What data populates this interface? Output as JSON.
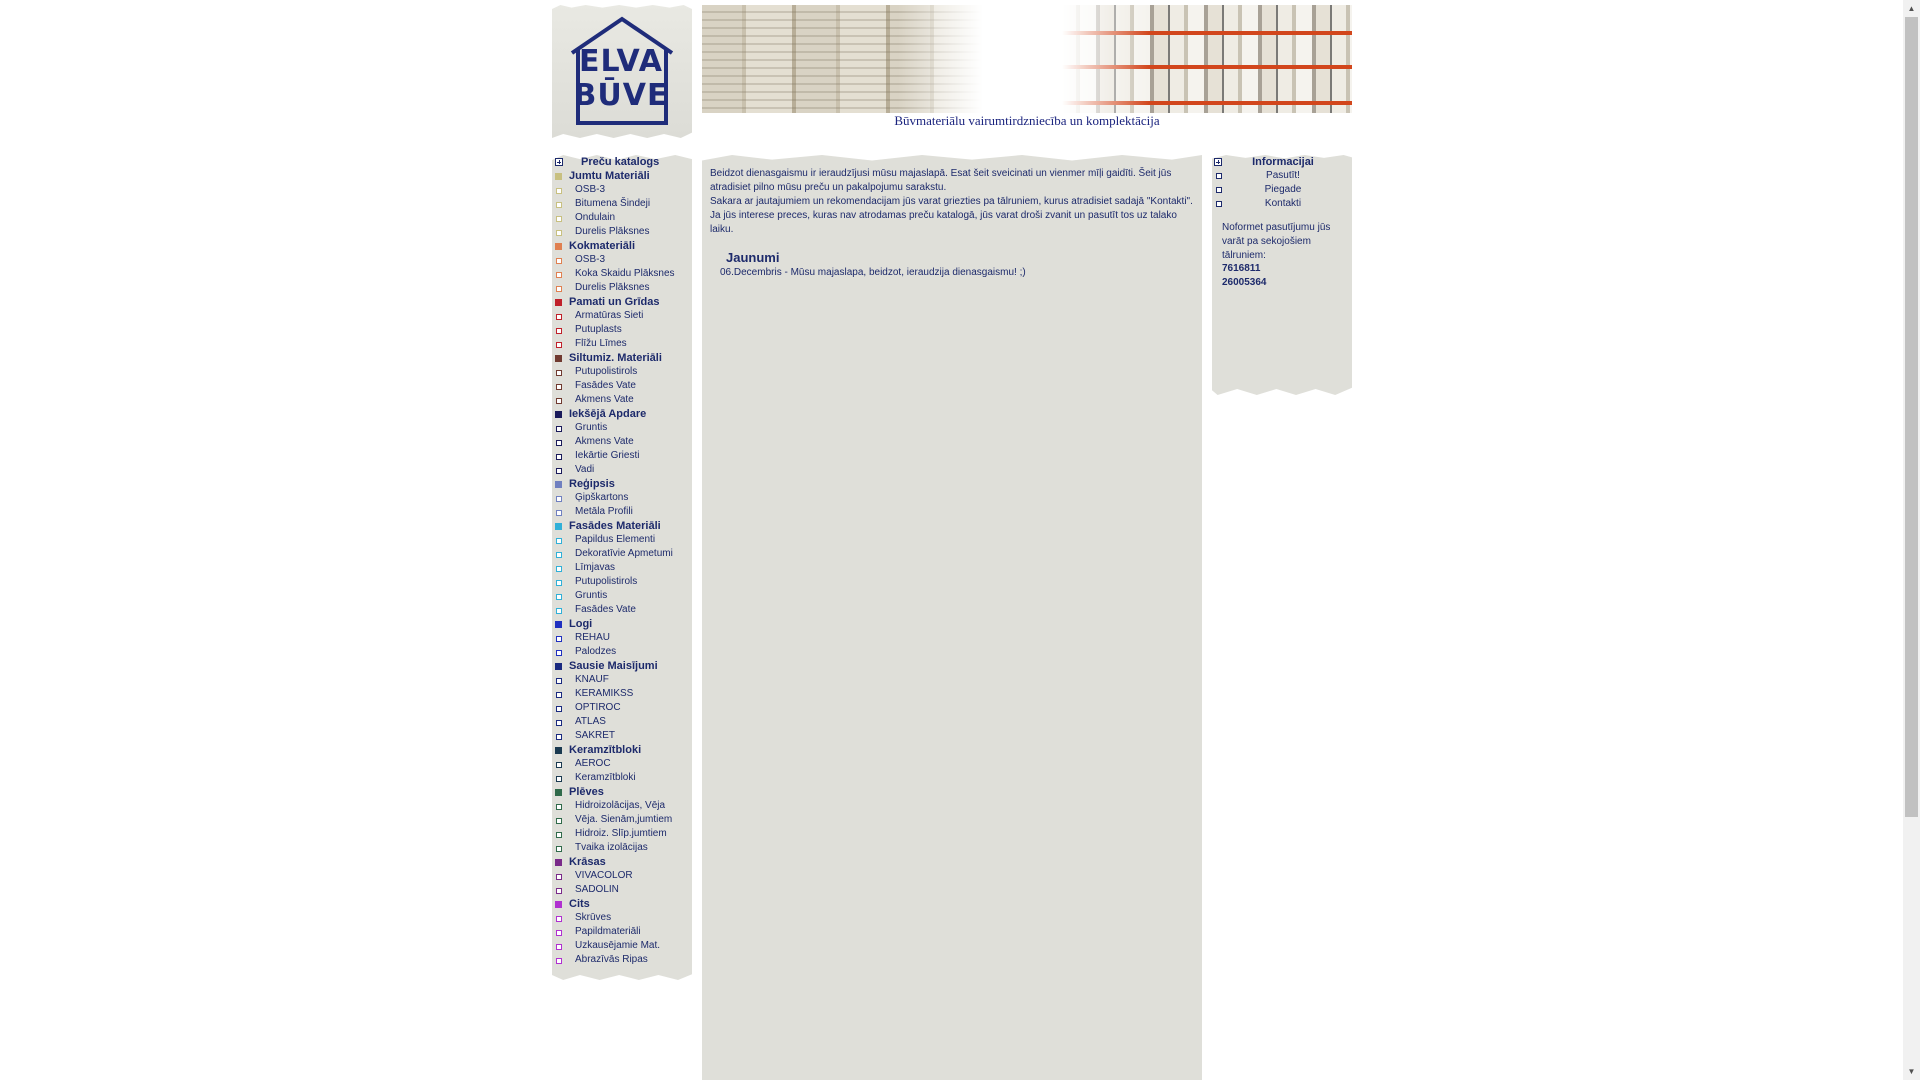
{
  "header": {
    "logo_line1": "ELVA",
    "logo_line2": "BŪVE",
    "tagline": "Būvmateriālu vairumtirdzniecība un komplektācija"
  },
  "catalog": {
    "title": "Preču katalogs",
    "categories": [
      {
        "name": "Jumtu Materiāli",
        "color": "#c8c080",
        "items": [
          "OSB-3",
          "Bitumena Šindeji",
          "Ondulain",
          "Durelis Plāksnes"
        ]
      },
      {
        "name": "Kokmateriāli",
        "color": "#e08050",
        "items": [
          "OSB-3",
          "Koka Skaidu Plāksnes",
          "Durelis Plāksnes"
        ]
      },
      {
        "name": "Pamati un Grīdas",
        "color": "#c0202a",
        "items": [
          "Armatūras Sieti",
          "Putuplasts",
          "Flīžu Līmes"
        ]
      },
      {
        "name": "Siltumiz. Materiāli",
        "color": "#703a30",
        "items": [
          "Putupolistirols",
          "Fasādes Vate",
          "Akmens Vate"
        ]
      },
      {
        "name": "Iekšējā Apdare",
        "color": "#1a1a5a",
        "items": [
          "Gruntis",
          "Akmens Vate",
          "Iekārtie Griesti",
          "Vadi"
        ]
      },
      {
        "name": "Reģipsis",
        "color": "#7080c0",
        "items": [
          "Ģipškartons",
          "Metāla Profili"
        ]
      },
      {
        "name": "Fasādes Materiāli",
        "color": "#30b0d8",
        "items": [
          "Papildus Elementi",
          "Dekoratīvie Apmetumi",
          "Līmjavas",
          "Putupolistirols",
          "Gruntis",
          "Fasādes Vate"
        ]
      },
      {
        "name": "Logi",
        "color": "#2030c0",
        "items": [
          "REHAU",
          "Palodzes"
        ]
      },
      {
        "name": "Sausie Maisījumi",
        "color": "#1a2a80",
        "items": [
          "KNAUF",
          "KERAMIKSS",
          "OPTIROC",
          "ATLAS",
          "SAKRET"
        ]
      },
      {
        "name": "Keramzītbloki",
        "color": "#1a3a50",
        "items": [
          "AEROC",
          "Keramzītbloki"
        ]
      },
      {
        "name": "Plēves",
        "color": "#306a4a",
        "items": [
          "Hidroizolācijas, Vēja",
          "Vēja. Sienām,jumtiem",
          "Hidroiz. Slīp.jumtiem",
          "Tvaika izolācijas"
        ]
      },
      {
        "name": "Krāsas",
        "color": "#7a2a8a",
        "items": [
          "VIVACOLOR",
          "SADOLIN"
        ]
      },
      {
        "name": "Cits",
        "color": "#b030d0",
        "items": [
          "Skrūves",
          "Papildmateriāli",
          "Uzkausējamie Mat.",
          "Abrazīvās Ripas"
        ]
      }
    ]
  },
  "main": {
    "paragraphs": [
      "Beidzot dienasgaismu ir ieraudzījusi mūsu majaslapā. Esat šeit sveicinati un vienmer mīļi gaidīti. Šeit jūs atradisiet pilno mūsu preču un pakalpojumu sarakstu.",
      "Sakara ar jautajumiem un rekomendacijam jūs varat griezties pa tālruniem, kurus atradisiet sadajā \"Kontakti\".",
      "Ja jūs interese preces, kuras nav atrodamas preču katalogā, jūs varat droši zvanit un pasutīt tos uz talako laiku."
    ],
    "news_title": "Jaunumi",
    "news_item": "06.Decembris - Mūsu majaslapa, beidzot, ieraudzija dienasgaismu! ;)"
  },
  "info": {
    "title": "Informacijai",
    "links": [
      "Pasutīt!",
      "Piegade",
      "Kontakti"
    ],
    "order_text": "Noformet pasutījumu jūs varāt pa sekojošiem tālruniem:",
    "phone1": "7616811",
    "phone2": "26005364"
  }
}
